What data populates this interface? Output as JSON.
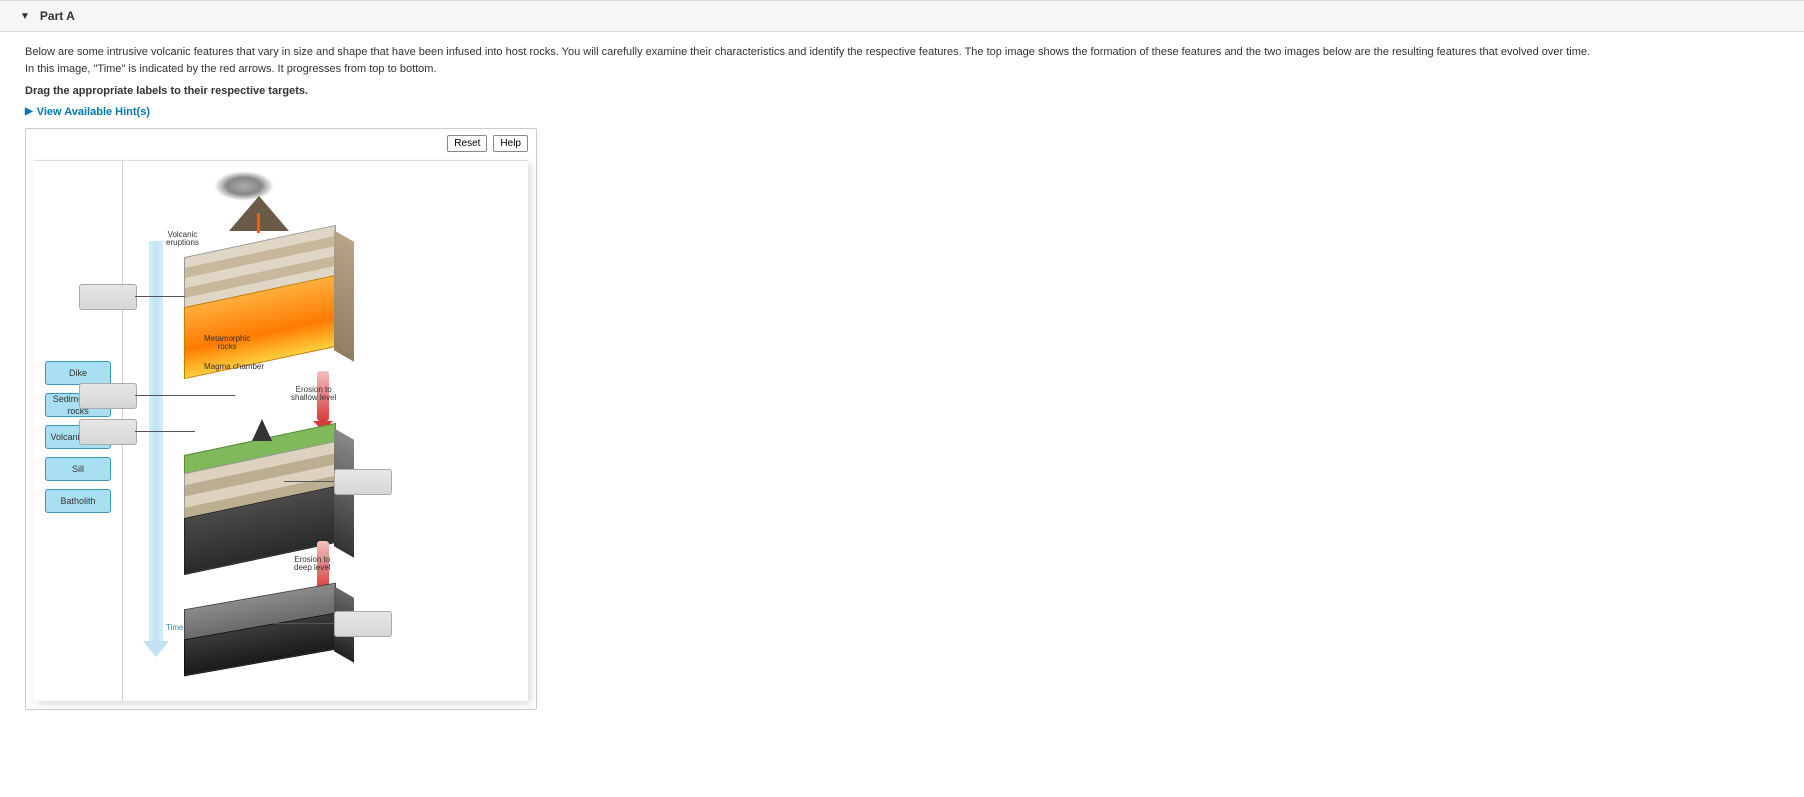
{
  "header": {
    "title": "Part A"
  },
  "description": {
    "line1": "Below are some intrusive volcanic features that vary in size and shape that have been infused into host rocks. You will carefully examine their characteristics and identify the respective features. The top image shows the formation of these features and the two images below are the resulting features that evolved over time.",
    "line2": "In this image, \"Time\" is indicated by the red arrows. It progresses from top to bottom."
  },
  "instruction": "Drag the appropriate labels to their respective targets.",
  "hints_label": "View Available Hint(s)",
  "toolbar": {
    "reset": "Reset",
    "help": "Help"
  },
  "labels": [
    "Dike",
    "Sedimentary rocks",
    "Volcanic neck",
    "Sill",
    "Batholith"
  ],
  "diagram_labels": {
    "volcanic_eruptions": "Volcanic\neruptions",
    "metamorphic_rocks": "Metamorphic\nrocks",
    "magma_chamber": "Magma chamber",
    "erosion_shallow": "Erosion to\nshallow level",
    "erosion_deep": "Erosion to\ndeep level",
    "time": "Time"
  }
}
